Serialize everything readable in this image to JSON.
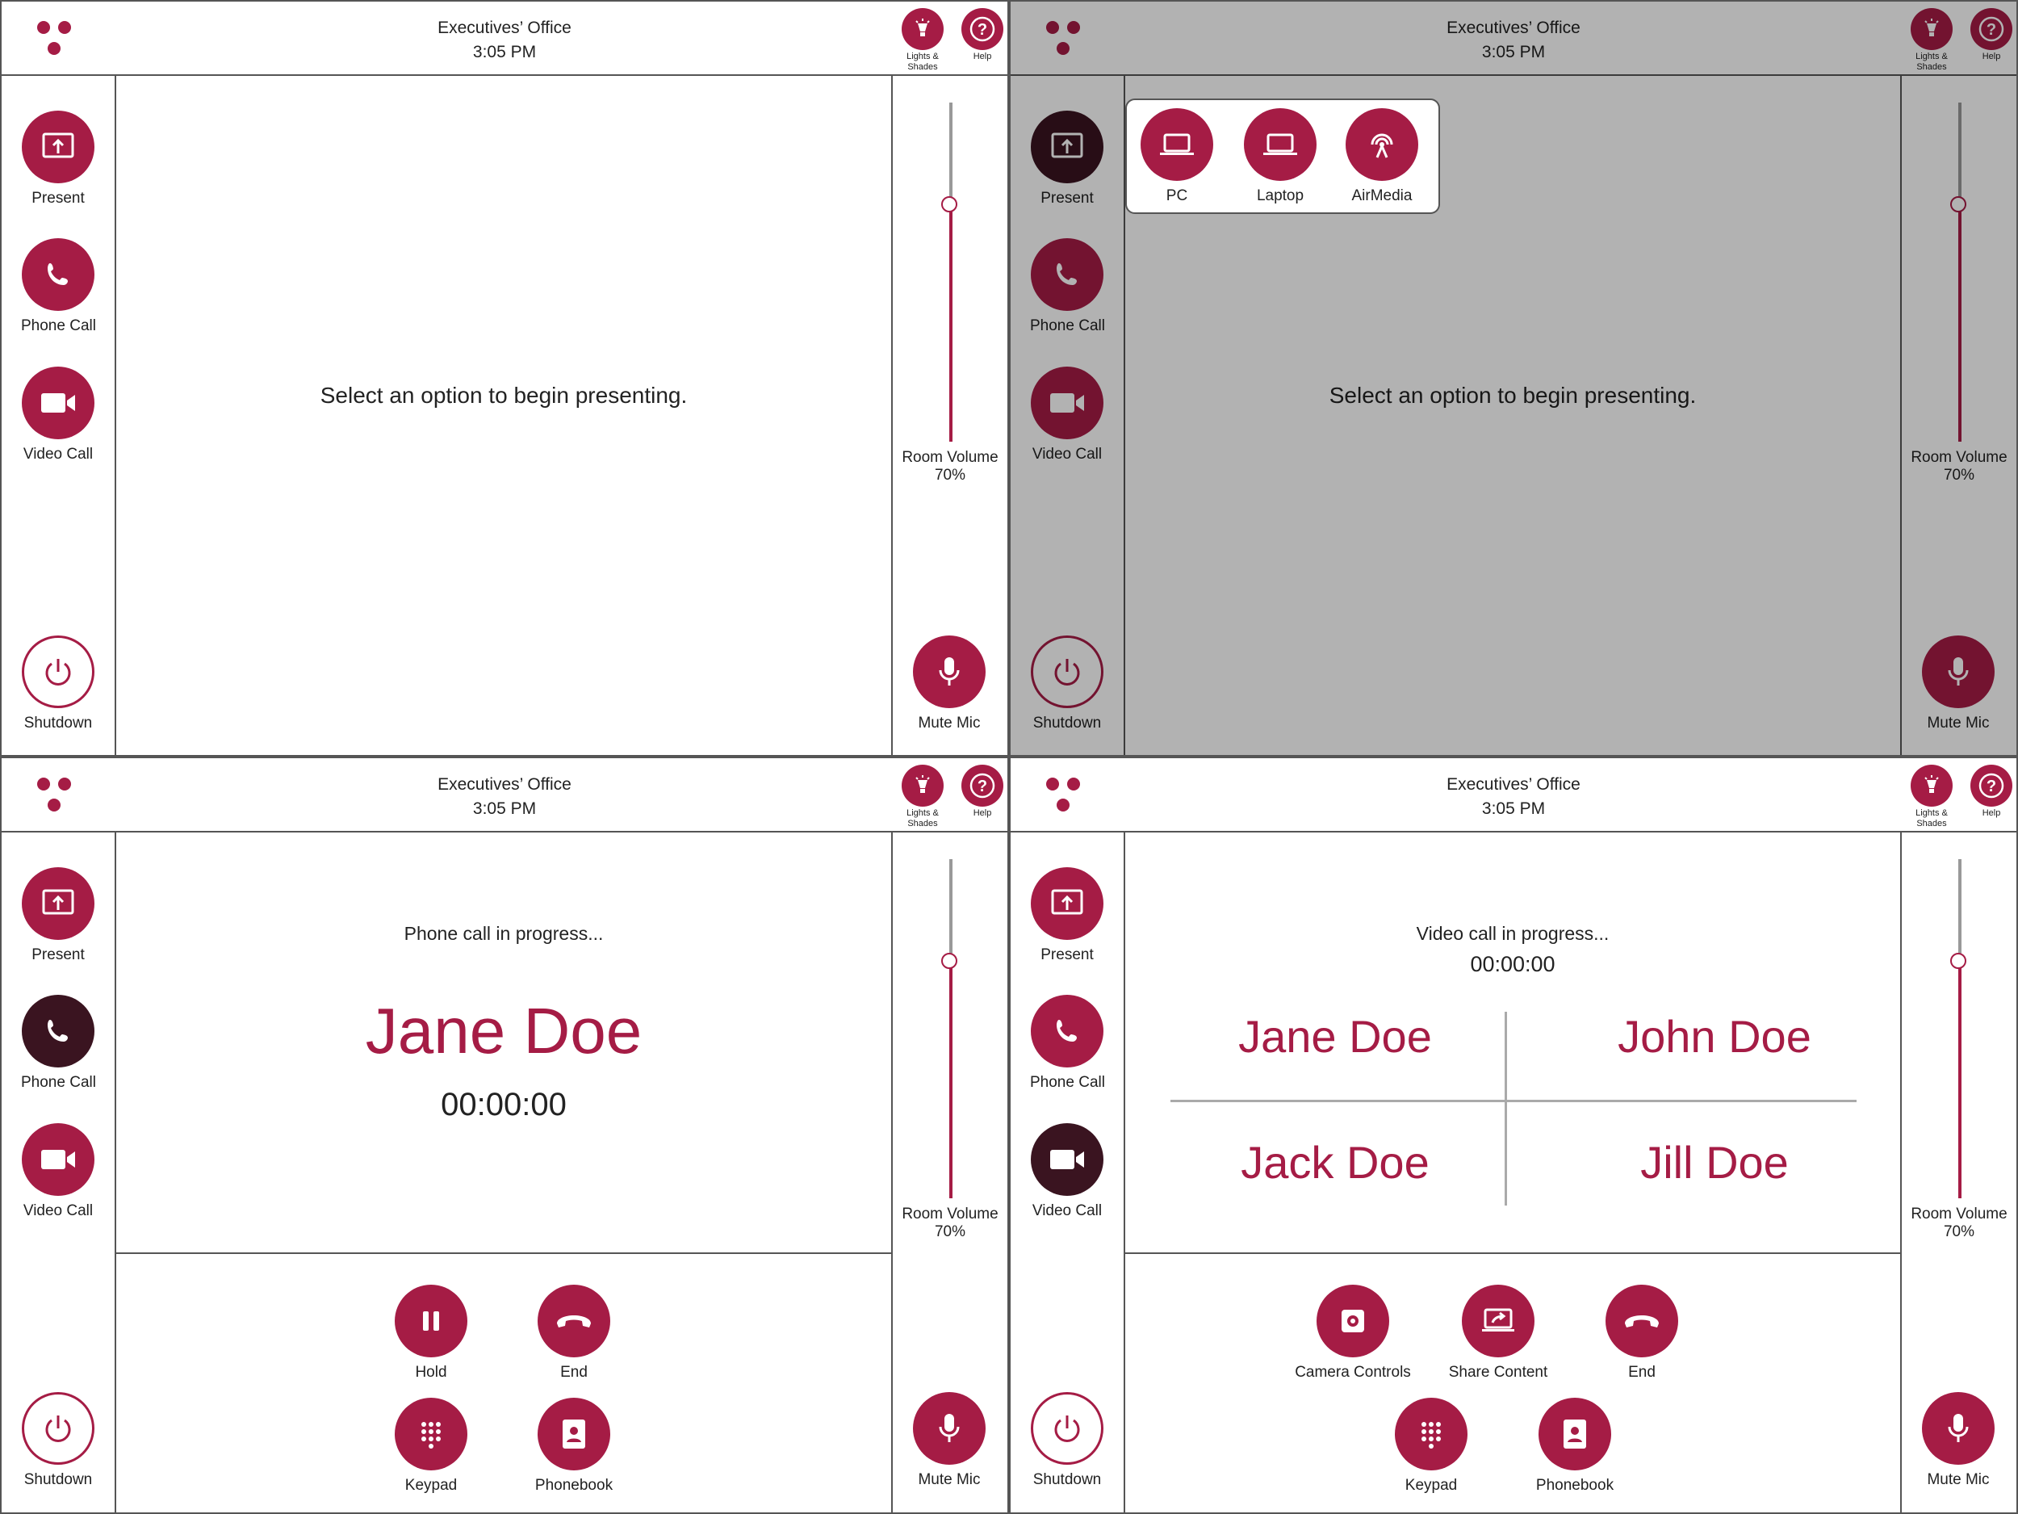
{
  "colors": {
    "accent": "#a51c45",
    "active": "#3a1420",
    "overlay": "rgba(0,0,0,0.30)"
  },
  "header": {
    "room": "Executives’ Office",
    "time": "3:05 PM",
    "lights_label": "Lights & Shades",
    "help_label": "Help"
  },
  "nav": {
    "present": "Present",
    "phone": "Phone Call",
    "video": "Video Call",
    "shutdown": "Shutdown"
  },
  "volume": {
    "label": "Room Volume",
    "value": "70%",
    "level": 0.7
  },
  "mute_label": "Mute Mic",
  "screen1": {
    "prompt": "Select an option to begin presenting."
  },
  "screen2": {
    "prompt": "Select an option to begin presenting.",
    "sources": [
      {
        "label": "PC",
        "icon": "laptop-icon"
      },
      {
        "label": "Laptop",
        "icon": "laptop-icon"
      },
      {
        "label": "AirMedia",
        "icon": "airmedia-icon"
      }
    ]
  },
  "screen3": {
    "status": "Phone call in progress...",
    "caller": "Jane Doe",
    "timer": "00:00:00",
    "controls": {
      "hold": "Hold",
      "end": "End",
      "keypad": "Keypad",
      "phonebook": "Phonebook"
    }
  },
  "screen4": {
    "status": "Video call in progress...",
    "timer": "00:00:00",
    "participants": [
      "Jane Doe",
      "John Doe",
      "Jack Doe",
      "Jill Doe"
    ],
    "controls": {
      "camera": "Camera Controls",
      "share": "Share Content",
      "end": "End",
      "keypad": "Keypad",
      "phonebook": "Phonebook"
    }
  }
}
